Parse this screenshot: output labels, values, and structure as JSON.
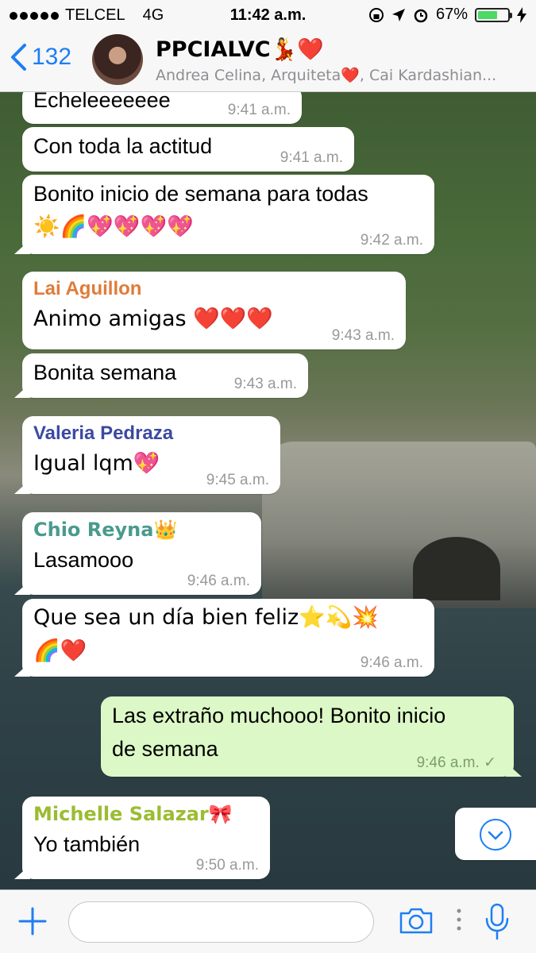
{
  "status_bar": {
    "carrier": "TELCEL",
    "network": "4G",
    "time": "11:42 a.m.",
    "battery": "67%",
    "battery_level": 0.67
  },
  "header": {
    "back_count": "132",
    "title": "PPCIALVC💃❤️",
    "subtitle": "Andrea Celina, Arquiteta❤️, Cai Kardashian..."
  },
  "messages": [
    {
      "text": "Echeleeeeeee",
      "time": "9:41 a.m."
    },
    {
      "text": "Con toda la actitud",
      "time": "9:41 a.m."
    },
    {
      "text": "Bonito inicio de semana para todas",
      "text2": "☀️🌈💖💖💖💖",
      "time": "9:42 a.m."
    },
    {
      "sender": "Lai Aguillon",
      "sender_color": "#e07b3a",
      "text": "Animo amigas ❤️❤️❤️",
      "time": "9:43 a.m."
    },
    {
      "text": "Bonita semana",
      "time": "9:43 a.m."
    },
    {
      "sender": "Valeria Pedraza",
      "sender_color": "#3a4aa3",
      "text": "Igual lqm💖",
      "time": "9:45 a.m."
    },
    {
      "sender": "Chio Reyna👑",
      "sender_color": "#4a9a8e",
      "text": "Lasamooo",
      "time": "9:46 a.m."
    },
    {
      "text": "Que sea un día bien feliz⭐️💫💥",
      "text2": "🌈❤️",
      "time": "9:46 a.m."
    },
    {
      "text": "Las extraño muchooo! Bonito inicio",
      "text2": "de semana",
      "time": "9:46 a.m. ✓",
      "outgoing": true
    },
    {
      "sender": "Michelle Salazar🎀",
      "sender_color": "#9bbc32",
      "text": "Yo también",
      "time": "9:50 a.m."
    }
  ],
  "icons": [
    "back-chevron-icon",
    "location-arrow-icon",
    "alarm-icon",
    "plus-icon",
    "camera-icon",
    "mic-icon",
    "chevron-down-icon"
  ]
}
